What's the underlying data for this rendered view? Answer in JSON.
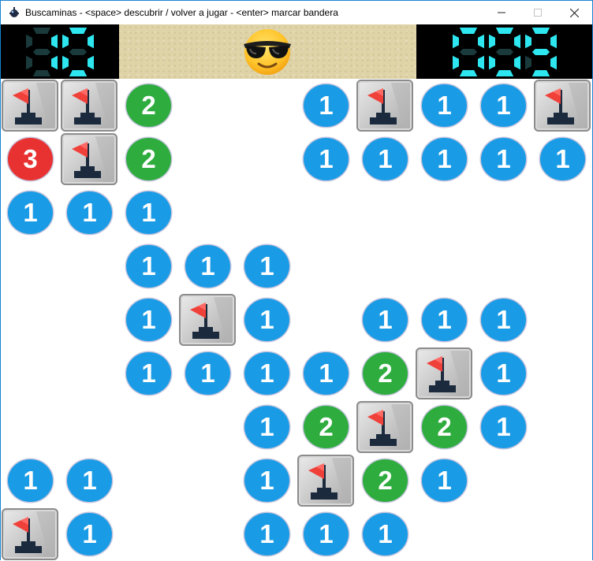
{
  "window": {
    "title": "Buscaminas - <space> descubrir / volver a jugar - <enter> marcar bandera",
    "app_icon": "minesweeper-app-icon",
    "controls": [
      "minimize",
      "maximize",
      "close"
    ]
  },
  "header": {
    "mines_counter": "10",
    "timer": "009",
    "face": "sunglasses-face",
    "colors": {
      "digit": "#2ee6f0",
      "digit_off": "#1a3a3c",
      "panel": "#dfd3a8"
    }
  },
  "number_colors": {
    "1": "#1a9be6",
    "2": "#2eac3e",
    "3": "#e83232"
  },
  "board": {
    "rows": 9,
    "cols": 10,
    "cells": [
      [
        "F",
        "F",
        "2",
        ".",
        ".",
        "1",
        "F",
        "1",
        "1",
        "F"
      ],
      [
        "3",
        "F",
        "2",
        ".",
        ".",
        "1",
        "1",
        "1",
        "1",
        "1"
      ],
      [
        "1",
        "1",
        "1",
        ".",
        ".",
        ".",
        ".",
        ".",
        ".",
        "."
      ],
      [
        ".",
        ".",
        "1",
        "1",
        "1",
        ".",
        ".",
        ".",
        ".",
        "."
      ],
      [
        ".",
        ".",
        "1",
        "F",
        "1",
        ".",
        "1",
        "1",
        "1",
        "."
      ],
      [
        ".",
        ".",
        "1",
        "1",
        "1",
        "1",
        "2",
        "F",
        "1",
        "."
      ],
      [
        ".",
        ".",
        ".",
        ".",
        "1",
        "2",
        "F",
        "2",
        "1",
        "."
      ],
      [
        "1",
        "1",
        ".",
        ".",
        "1",
        "F",
        "2",
        "1",
        ".",
        "."
      ],
      [
        "F",
        "1",
        ".",
        ".",
        "1",
        "1",
        "1",
        ".",
        ".",
        "."
      ]
    ]
  }
}
